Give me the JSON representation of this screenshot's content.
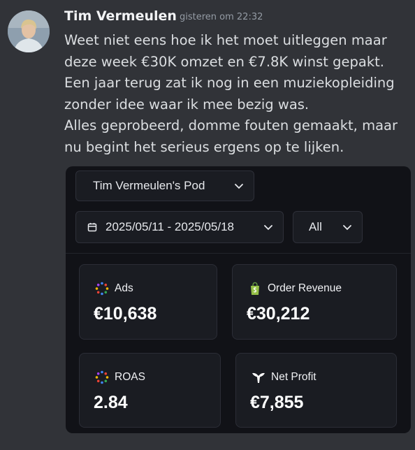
{
  "message": {
    "author": "Tim Vermeulen",
    "timestamp": "gisteren om 22:32",
    "lines": [
      "Weet niet eens hoe ik het moet uitleggen maar",
      "deze week €30K omzet en €7.8K winst gepakt.",
      "Een jaar terug zat ik nog in een muziekopleiding",
      "zonder idee waar ik mee bezig was.",
      "Alles geprobeerd, domme fouten gemaakt, maar",
      "nu begint het serieus ergens op te lijken."
    ]
  },
  "dashboard": {
    "pod_select": "Tim Vermeulen's Pod",
    "date_range": "2025/05/11 - 2025/05/18",
    "filter": "All",
    "metrics": [
      {
        "label": "Ads",
        "value": "€10,638",
        "icon": "ads-dots-icon"
      },
      {
        "label": "Order Revenue",
        "value": "€30,212",
        "icon": "shopify-bag-icon"
      },
      {
        "label": "ROAS",
        "value": "2.84",
        "icon": "ads-dots-icon"
      },
      {
        "label": "Net Profit",
        "value": "€7,855",
        "icon": "triple-whale-icon"
      }
    ]
  },
  "colors": {
    "background": "#313338",
    "card": "#111217",
    "tile": "#1a1c22",
    "shopify_green": "#95bf47"
  }
}
